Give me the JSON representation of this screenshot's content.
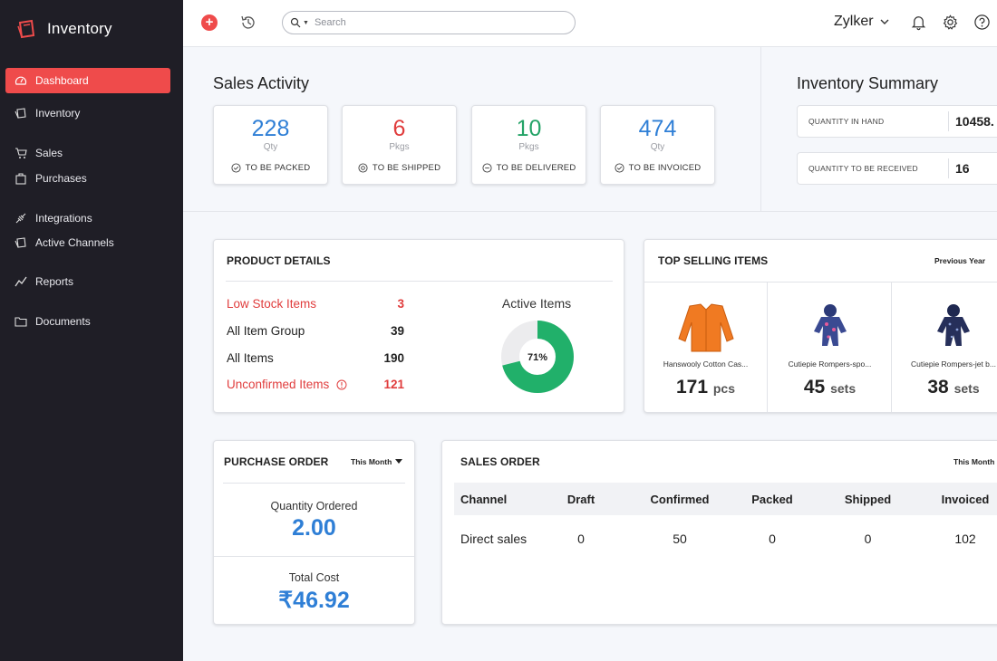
{
  "app": {
    "title": "Inventory"
  },
  "sidebar": {
    "items": [
      {
        "label": "Dashboard",
        "icon": "dashboard-icon",
        "active": true
      },
      {
        "label": "Inventory",
        "icon": "inventory-icon"
      },
      {
        "label": "Sales",
        "icon": "cart-icon"
      },
      {
        "label": "Purchases",
        "icon": "bag-icon"
      },
      {
        "label": "Integrations",
        "icon": "integrations-icon"
      },
      {
        "label": "Active Channels",
        "icon": "channels-icon"
      },
      {
        "label": "Reports",
        "icon": "reports-icon"
      },
      {
        "label": "Documents",
        "icon": "folder-icon"
      }
    ]
  },
  "topbar": {
    "search_placeholder": "Search",
    "org_name": "Zylker"
  },
  "sales_activity": {
    "title": "Sales Activity",
    "cards": [
      {
        "value": "228",
        "unit": "Qty",
        "label": "TO BE PACKED",
        "color": "#2f7fd6"
      },
      {
        "value": "6",
        "unit": "Pkgs",
        "label": "TO BE SHIPPED",
        "color": "#e03c3c"
      },
      {
        "value": "10",
        "unit": "Pkgs",
        "label": "TO BE DELIVERED",
        "color": "#24a367"
      },
      {
        "value": "474",
        "unit": "Qty",
        "label": "TO BE INVOICED",
        "color": "#2f7fd6"
      }
    ]
  },
  "inventory_summary": {
    "title": "Inventory Summary",
    "rows": [
      {
        "label": "QUANTITY IN HAND",
        "value": "10458."
      },
      {
        "label": "QUANTITY TO BE RECEIVED",
        "value": "16"
      }
    ]
  },
  "product_details": {
    "title": "PRODUCT DETAILS",
    "rows": [
      {
        "label": "Low Stock Items",
        "value": "3",
        "alert": true
      },
      {
        "label": "All Item Group",
        "value": "39"
      },
      {
        "label": "All Items",
        "value": "190"
      },
      {
        "label": "Unconfirmed Items",
        "value": "121",
        "alert": true
      }
    ],
    "active_items_label": "Active Items",
    "active_items_percent": "71%",
    "active_items_fraction": 0.71,
    "donut_color": "#21b06a"
  },
  "top_selling": {
    "title": "TOP SELLING ITEMS",
    "period": "Previous Year",
    "items": [
      {
        "name": "Hanswooly Cotton Cas...",
        "qty": "171",
        "unit": "pcs"
      },
      {
        "name": "Cutiepie Rompers-spo...",
        "qty": "45",
        "unit": "sets"
      },
      {
        "name": "Cutiepie Rompers-jet b...",
        "qty": "38",
        "unit": "sets"
      }
    ]
  },
  "purchase_order": {
    "title": "PURCHASE ORDER",
    "period": "This Month",
    "qty_label": "Quantity Ordered",
    "qty_value": "2.00",
    "cost_label": "Total Cost",
    "cost_value": "₹46.92"
  },
  "sales_order": {
    "title": "SALES ORDER",
    "period": "This Month",
    "columns": [
      "Channel",
      "Draft",
      "Confirmed",
      "Packed",
      "Shipped",
      "Invoiced"
    ],
    "rows": [
      [
        "Direct sales",
        "0",
        "50",
        "0",
        "0",
        "102"
      ]
    ]
  }
}
